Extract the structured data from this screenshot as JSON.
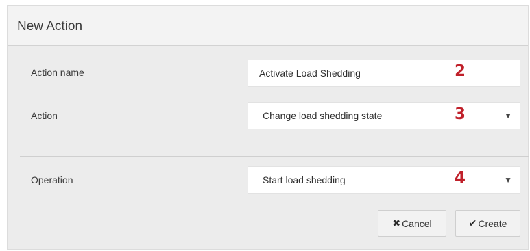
{
  "dialog": {
    "title": "New Action"
  },
  "form": {
    "action_name": {
      "label": "Action name",
      "value": "Activate Load Shedding",
      "callout": "2"
    },
    "action": {
      "label": "Action",
      "selected": "Change load shedding state",
      "callout": "3"
    },
    "operation": {
      "label": "Operation",
      "selected": "Start load shedding",
      "callout": "4"
    }
  },
  "buttons": {
    "cancel_icon": "✖",
    "cancel_label": "Cancel",
    "create_icon": "✔",
    "create_label": "Create"
  },
  "icons": {
    "dropdown": "▼"
  },
  "colors": {
    "callout": "#c0202a",
    "panel_background": "#ececec",
    "header_background": "#f3f3f3"
  }
}
